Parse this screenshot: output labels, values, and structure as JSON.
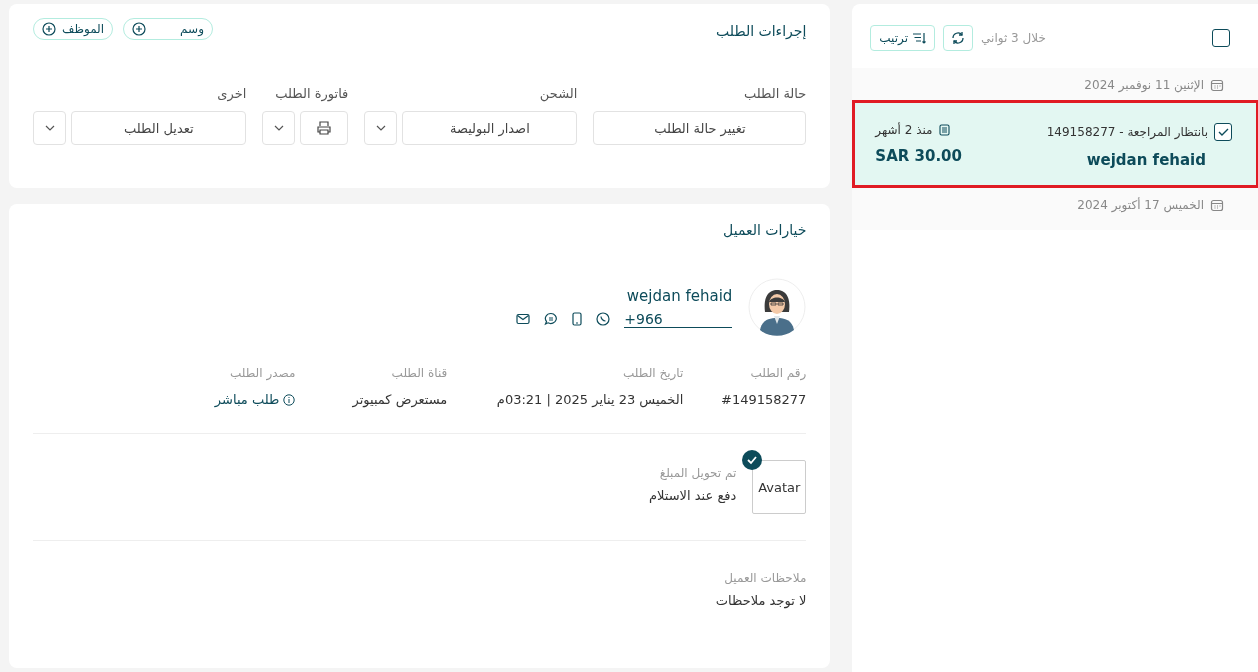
{
  "order_list": {
    "select_all_checked": false,
    "refresh_hint": "خلال 3 ثواني",
    "sort_button": "ترتيب",
    "groups": [
      {
        "date": "الإثنين 11 نوفمبر 2024",
        "orders": [
          {
            "status_number": "بانتظار المراجعة - 149158277",
            "age": "منذ 2 أشهر",
            "customer": "wejdan fehaid",
            "total": "SAR 30.00",
            "checked": true,
            "selected": true
          }
        ]
      },
      {
        "date": "الخميس 17 أكتوبر 2024"
      }
    ]
  },
  "order_actions": {
    "title": "إجراءات الطلب",
    "chips": [
      {
        "label": "وسم"
      },
      {
        "label": "الموظف"
      }
    ],
    "groups": [
      {
        "kind": "button",
        "label": "حالة الطلب",
        "button": "تغيير حالة الطلب",
        "dropdown": false
      },
      {
        "kind": "button",
        "label": "الشحن",
        "button": "اصدار البوليصة",
        "dropdown": true
      },
      {
        "kind": "print",
        "label": "فاتورة الطلب",
        "dropdown": true
      },
      {
        "kind": "button",
        "label": "اخرى",
        "button": "تعديل الطلب",
        "dropdown": true
      }
    ]
  },
  "customer_options": {
    "title": "خيارات العميل",
    "name": "wejdan fehaid",
    "phone": "+966",
    "details": [
      {
        "kind": "text",
        "label": "رقم الطلب",
        "value": "#149158277"
      },
      {
        "kind": "text",
        "label": "تاريخ الطلب",
        "value": "الخميس 23 يناير 2025 | 03:21م"
      },
      {
        "kind": "text",
        "label": "قناة الطلب",
        "value": "مستعرض كمبيوتر"
      },
      {
        "kind": "link",
        "label": "مصدر الطلب",
        "value": "طلب مباشر"
      }
    ],
    "payment": {
      "image_alt": "Avatar",
      "verified": true,
      "label": "تم تحويل المبلغ",
      "value": "دفع عند الاستلام"
    },
    "notes": {
      "label": "ملاحظات العميل",
      "value": "لا توجد ملاحظات"
    }
  }
}
